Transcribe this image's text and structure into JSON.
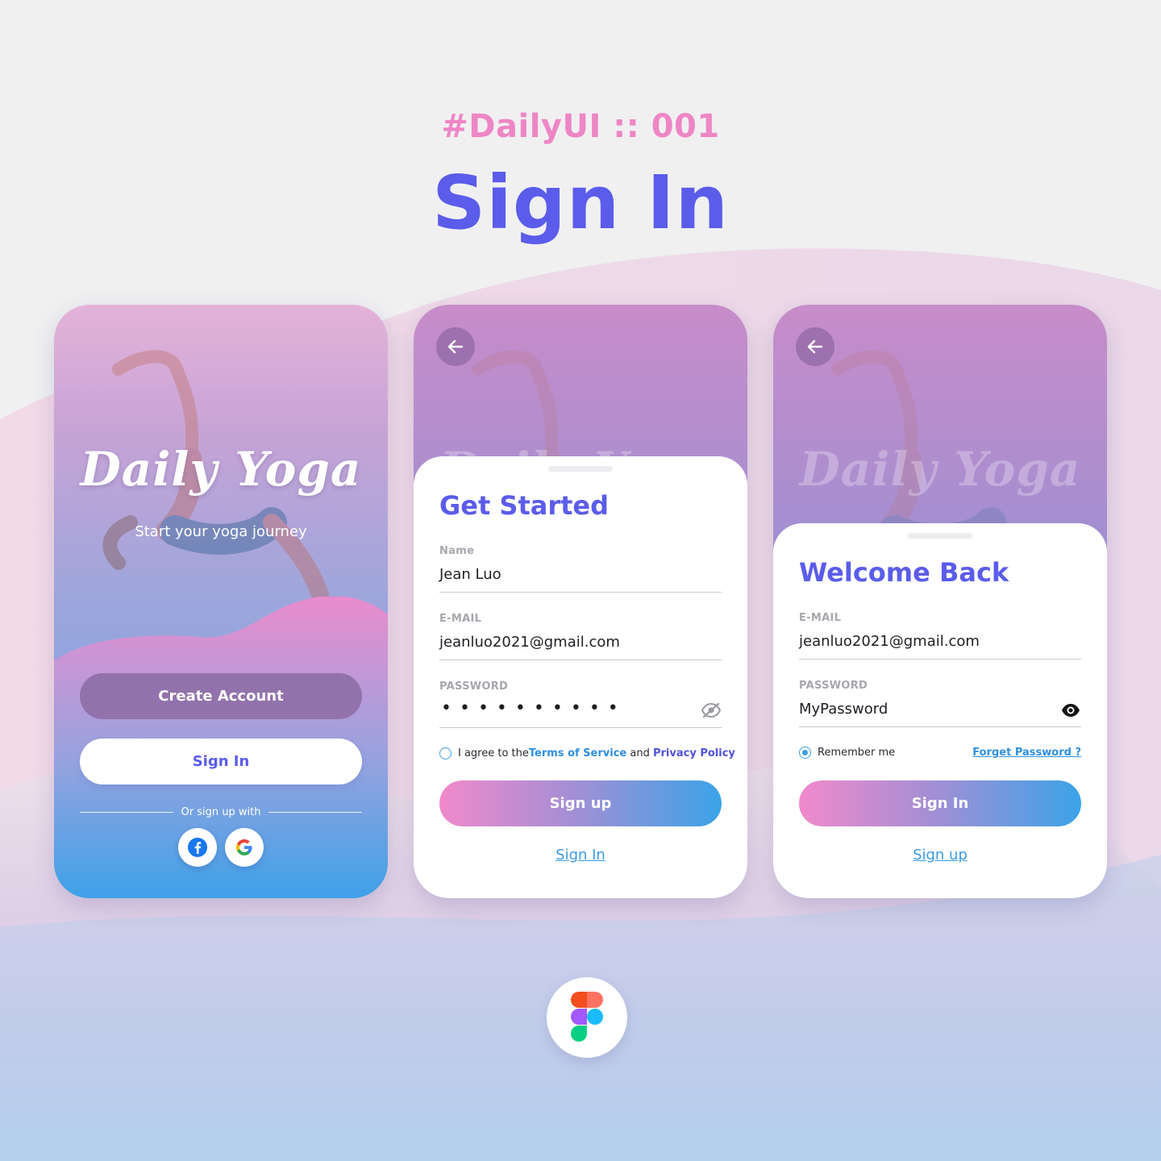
{
  "header": {
    "tag": "#DailyUI :: 001",
    "title": "Sign In"
  },
  "colors": {
    "accent_purple": "#5b5cea",
    "accent_pink": "#ee86c6",
    "accent_blue": "#3ba3e8"
  },
  "screen1": {
    "brand": "Daily Yoga",
    "tagline": "Start your yoga journey",
    "create_account": "Create Account",
    "sign_in": "Sign In",
    "or_sign_up_with": "Or sign up with",
    "social": [
      "facebook-icon",
      "google-icon"
    ]
  },
  "screen2": {
    "brand": "Daily Yoga",
    "title": "Get Started",
    "name_label": "Name",
    "name_value": "Jean Luo",
    "email_label": "E-MAIL",
    "email_value": "jeanluo2021@gmail.com",
    "password_label": "PASSWORD",
    "password_masked": "••••••••••",
    "agree_prefix": "I agree to the ",
    "terms": "Terms of Service",
    "and": " and ",
    "privacy": "Privacy Policy",
    "primary": "Sign up",
    "secondary_link": "Sign In"
  },
  "screen3": {
    "brand": "Daily Yoga",
    "title": "Welcome Back",
    "email_label": "E-MAIL",
    "email_value": "jeanluo2021@gmail.com",
    "password_label": "PASSWORD",
    "password_value": "MyPassword",
    "remember": "Remember me",
    "forgot": "Forget Password ?",
    "primary": "Sign In",
    "secondary_link": "Sign up"
  },
  "footer": {
    "tool_icon": "figma-icon"
  }
}
